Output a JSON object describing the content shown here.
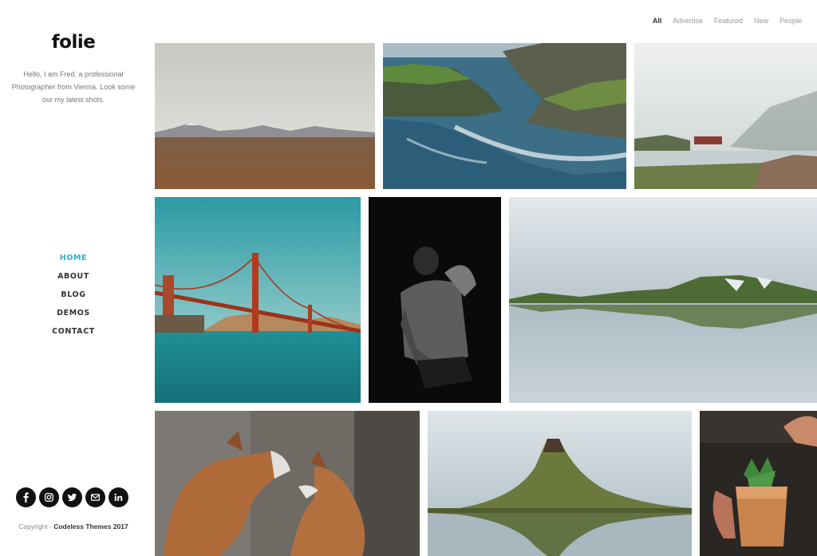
{
  "brand": {
    "logo_text": "folie",
    "intro": "Hello, I am Fred, a professional Photographer from Vienna. Look some our my latest shots."
  },
  "nav": {
    "items": [
      {
        "label": "HOME",
        "active": true
      },
      {
        "label": "ABOUT",
        "active": false
      },
      {
        "label": "BLOG",
        "active": false
      },
      {
        "label": "DEMOS",
        "active": false
      },
      {
        "label": "CONTACT",
        "active": false
      }
    ]
  },
  "filters": {
    "items": [
      {
        "label": "All",
        "active": true
      },
      {
        "label": "Advertise",
        "active": false
      },
      {
        "label": "Featured",
        "active": false
      },
      {
        "label": "New",
        "active": false
      },
      {
        "label": "People",
        "active": false
      }
    ]
  },
  "social": {
    "icons": [
      "facebook-icon",
      "instagram-icon",
      "twitter-icon",
      "email-icon",
      "linkedin-icon"
    ]
  },
  "footer": {
    "copyright_prefix": "Copyright - ",
    "copyright_owner": "Codeless Themes 2017"
  },
  "gallery": {
    "tiles": [
      {
        "subject": "desert-mountains-photo"
      },
      {
        "subject": "rocky-coast-photo"
      },
      {
        "subject": "misty-lake-photo"
      },
      {
        "subject": "golden-gate-bridge-photo"
      },
      {
        "subject": "man-in-dark-portrait-photo"
      },
      {
        "subject": "lake-reflection-hills-photo"
      },
      {
        "subject": "two-foxes-photo"
      },
      {
        "subject": "kirkjufell-mountain-photo"
      },
      {
        "subject": "copper-mug-cocktail-photo"
      }
    ]
  },
  "colors": {
    "accent": "#2fb2c9",
    "text_dark": "#333333",
    "text_muted": "#777777",
    "social_bg": "#111111"
  }
}
